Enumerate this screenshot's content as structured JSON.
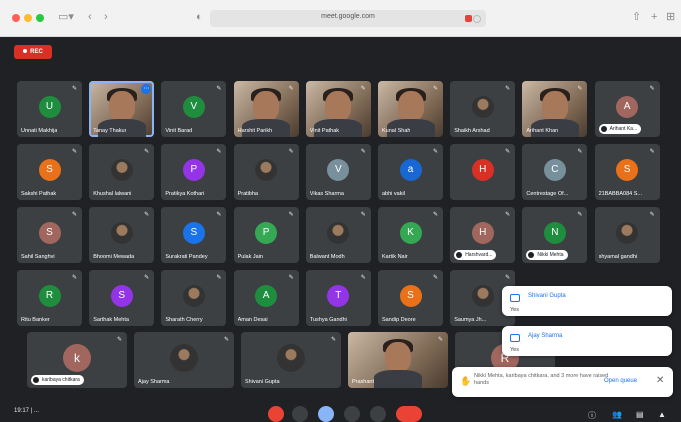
{
  "browser": {
    "url": "meet.google.com"
  },
  "meet": {
    "rec_label": "REC",
    "time": "19:17 | ..."
  },
  "tiles": [
    {
      "name": "Unnati Makhija",
      "initial": "U",
      "color": "#1e8e3e"
    },
    {
      "name": "Tanay Thakur",
      "photo": true,
      "active": true
    },
    {
      "name": "Vinit Barad",
      "initial": "V",
      "color": "#1e8e3e"
    },
    {
      "name": "Harshit Parikh",
      "photo": true
    },
    {
      "name": "Vinit Pathak",
      "photo": true
    },
    {
      "name": "Kunal Shah",
      "photo": true
    },
    {
      "name": "Shaikh Arshad",
      "avatar_img": true
    },
    {
      "name": "Arihant Khan",
      "photo": true
    },
    {
      "name": "Arihant Ka...",
      "initial": "A",
      "color": "#a1665e",
      "hand": true
    },
    {
      "name": "Sakshi Pathak",
      "initial": "S",
      "color": "#e8711a"
    },
    {
      "name": "Khushal lalwani",
      "avatar_img": true
    },
    {
      "name": "Pratikya Kothari",
      "initial": "P",
      "color": "#9334e6"
    },
    {
      "name": "Pratibha",
      "avatar_img": true
    },
    {
      "name": "Vikas Sharma",
      "initial": "V",
      "color": "#78909c"
    },
    {
      "name": "abhi vakil",
      "initial": "a",
      "color": "#1967d2"
    },
    {
      "name": "",
      "initial": "H",
      "color": "#d93025"
    },
    {
      "name": "Centrestage Of...",
      "initial": "C",
      "color": "#78909c"
    },
    {
      "name": "21BABBA084 S...",
      "initial": "S",
      "color": "#e8711a"
    },
    {
      "name": "Sahil Sanghvi",
      "initial": "S",
      "color": "#a1665e"
    },
    {
      "name": "Bhoomi Mewada",
      "avatar_img": true
    },
    {
      "name": "Surakrati Pandey",
      "initial": "S",
      "color": "#1a73e8"
    },
    {
      "name": "Pulak Jain",
      "initial": "P",
      "color": "#34a853"
    },
    {
      "name": "Balwant Modh",
      "avatar_img": true
    },
    {
      "name": "Kartik Nair",
      "initial": "K",
      "color": "#34a853"
    },
    {
      "name": "Harshvard...",
      "initial": "H",
      "color": "#a1665e",
      "hand": true
    },
    {
      "name": "Nikki Mehta",
      "initial": "N",
      "color": "#1e8e3e",
      "hand": true
    },
    {
      "name": "shyamal gandhi",
      "avatar_img": true
    },
    {
      "name": "Ritu Banker",
      "initial": "R",
      "color": "#1e8e3e"
    },
    {
      "name": "Sarthak Mehta",
      "initial": "S",
      "color": "#9334e6"
    },
    {
      "name": "Sharath Cherry",
      "avatar_img": true
    },
    {
      "name": "Aman Desai",
      "initial": "A",
      "color": "#1e8e3e"
    },
    {
      "name": "Tushya Gandhi",
      "initial": "T",
      "color": "#9334e6"
    },
    {
      "name": "Sandip Deore",
      "initial": "S",
      "color": "#e8711a"
    },
    {
      "name": "Saumya Jh...",
      "avatar_img": true
    },
    {
      "name": "karibaya chitkara",
      "initial": "k",
      "color": "#a1665e",
      "hand": true,
      "large": true
    },
    {
      "name": "Ajay Sharma",
      "avatar_img": true,
      "large": true
    },
    {
      "name": "Shivani Gupta",
      "avatar_img": true,
      "large": true
    },
    {
      "name": "Prashant",
      "photo": true,
      "large": true
    },
    {
      "name": "",
      "initial": "R",
      "color": "#a1665e",
      "large": true
    }
  ],
  "raised_hands": [
    {
      "name": "Shivani Gupta",
      "status": "Yes"
    },
    {
      "name": "Ajay Sharma",
      "status": "Yes"
    }
  ],
  "hands_toast": {
    "text": "Nikki Mehta, karibaya chitkara, and 3 more have raised hands",
    "action": "Open queue",
    "close": "✕"
  },
  "controls": {
    "mic": "mic-off-icon",
    "cam": "camera-icon",
    "cc": "captions-icon",
    "hand": "raise-hand-icon",
    "present": "present-icon",
    "more": "more-icon",
    "end": "end-call-icon"
  },
  "colors": {
    "background": "#202124",
    "tile": "#3c4043",
    "accent": "#1a73e8",
    "rec": "#d93025"
  }
}
